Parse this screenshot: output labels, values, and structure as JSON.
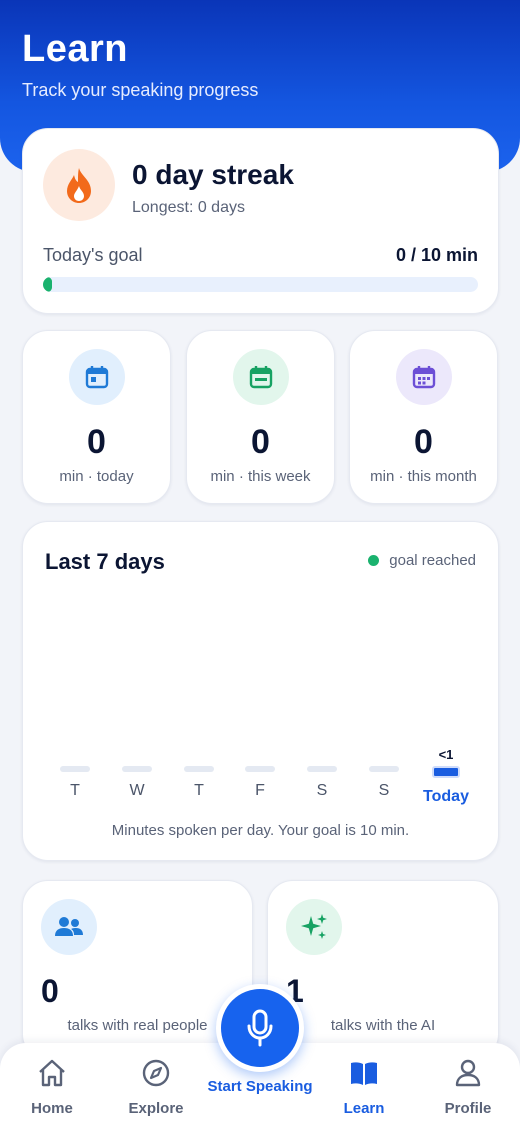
{
  "header": {
    "title": "Learn",
    "subtitle": "Track your speaking progress"
  },
  "streak": {
    "title": "0 day streak",
    "longest": "Longest: 0 days",
    "goal_label": "Today's goal",
    "goal_value": "0 / 10 min",
    "goal_progress_fraction": 0.0
  },
  "stats": [
    {
      "value": "0",
      "label": "min · today",
      "icon": "calendar-day-icon"
    },
    {
      "value": "0",
      "label": "min · this week",
      "icon": "calendar-week-icon"
    },
    {
      "value": "0",
      "label": "min · this month",
      "icon": "calendar-month-icon"
    }
  ],
  "week": {
    "title": "Last 7 days",
    "legend": "goal reached",
    "days": [
      {
        "label": "T",
        "value": ""
      },
      {
        "label": "W",
        "value": ""
      },
      {
        "label": "T",
        "value": ""
      },
      {
        "label": "F",
        "value": ""
      },
      {
        "label": "S",
        "value": ""
      },
      {
        "label": "S",
        "value": ""
      },
      {
        "label": "Today",
        "value": "<1"
      }
    ],
    "note": "Minutes spoken per day. Your goal is 10 min."
  },
  "talks": [
    {
      "value": "0",
      "label": "talks with real people",
      "icon": "people-icon"
    },
    {
      "value": "1",
      "label": "talks with the AI",
      "icon": "sparkles-icon"
    }
  ],
  "nav": {
    "home": "Home",
    "explore": "Explore",
    "start": "Start Speaking",
    "learn": "Learn",
    "profile": "Profile",
    "active": "learn"
  },
  "colors": {
    "primary": "#1763ee",
    "success": "#1ab26e",
    "streak_bg": "#fdeadf",
    "streak_flame": "#f26a1b"
  }
}
